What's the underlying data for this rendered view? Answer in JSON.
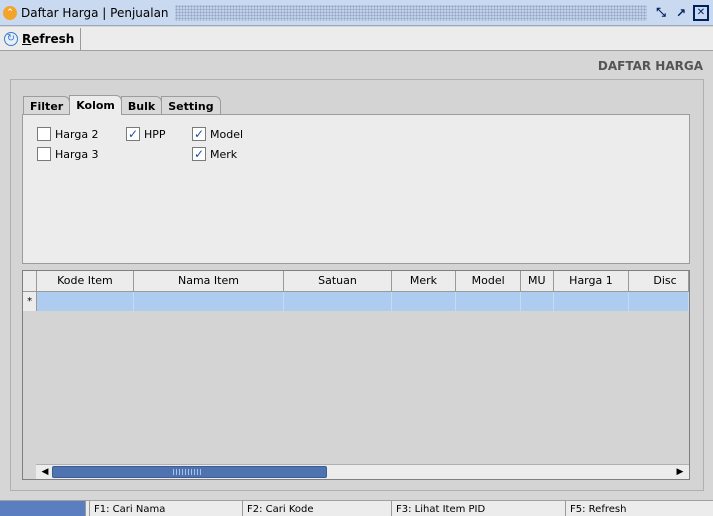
{
  "window": {
    "title": "Daftar Harga | Penjualan",
    "btn_restore": "⤡",
    "btn_maximize": "↗",
    "btn_close": "✕"
  },
  "toolbar": {
    "refresh_label_first": "R",
    "refresh_label_rest": "efresh"
  },
  "page": {
    "header": "DAFTAR HARGA"
  },
  "tabs": [
    {
      "label": "Filter",
      "active": false
    },
    {
      "label": "Kolom",
      "active": true
    },
    {
      "label": "Bulk",
      "active": false
    },
    {
      "label": "Setting",
      "active": false
    }
  ],
  "columns_panel": {
    "checkboxes": [
      {
        "label": "Harga 2",
        "checked": false
      },
      {
        "label": "Harga 3",
        "checked": false
      },
      {
        "label": "HPP",
        "checked": true
      },
      {
        "label": "Model",
        "checked": true
      },
      {
        "label": "Merk",
        "checked": true
      }
    ]
  },
  "grid": {
    "columns": [
      "Kode Item",
      "Nama Item",
      "Satuan",
      "Merk",
      "Model",
      "MU",
      "Harga 1",
      "Disc"
    ],
    "new_row_marker": "*"
  },
  "statusbar": {
    "f1": "F1: Cari Nama",
    "f2": "F2: Cari Kode",
    "f3": "F3: Lihat Item PID",
    "f5": "F5: Refresh"
  },
  "colors": {
    "titlebar": "#c9d9f0",
    "selected_row": "#aeccf0",
    "scroll_thumb": "#4f72b0"
  }
}
